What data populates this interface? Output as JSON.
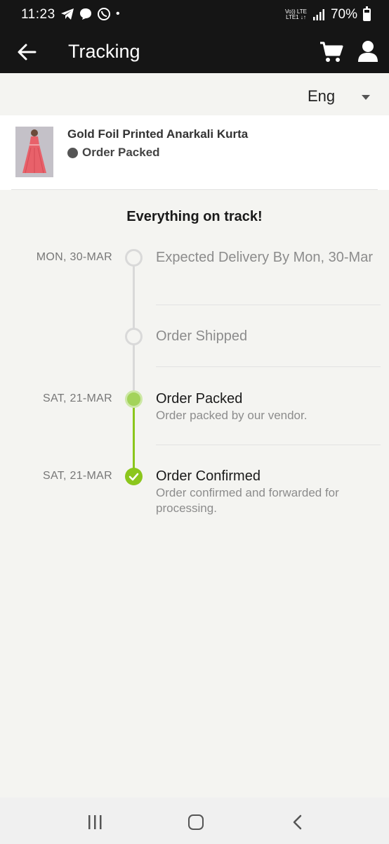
{
  "status_bar": {
    "time": "11:23",
    "dot": "•",
    "network_top": "Vo)) LTE",
    "network_bottom": "LTE1 ↓↑",
    "battery": "70%"
  },
  "app_bar": {
    "title": "Tracking",
    "icons": [
      "back-arrow-icon",
      "cart-icon",
      "user-icon"
    ]
  },
  "language": {
    "selected": "Eng"
  },
  "product": {
    "name": "Gold Foil Printed Anarkali Kurta",
    "status": "Order Packed"
  },
  "headline": "Everything on track!",
  "timeline": [
    {
      "date": "MON, 30-MAR",
      "label": "Expected Delivery By Mon, 30-Mar",
      "desc": "",
      "state": "pending"
    },
    {
      "date": "",
      "label": "Order Shipped",
      "desc": "",
      "state": "pending"
    },
    {
      "date": "SAT, 21-MAR",
      "label": "Order Packed",
      "desc": "Order packed by our vendor.",
      "state": "current"
    },
    {
      "date": "SAT, 21-MAR",
      "label": "Order Confirmed",
      "desc": "Order confirmed and forwarded for processing.",
      "state": "done"
    }
  ],
  "colors": {
    "bar": "#151515",
    "background": "#f4f4f1",
    "accent_green": "#8bc61c",
    "pending_gray": "#d9d9d9"
  }
}
